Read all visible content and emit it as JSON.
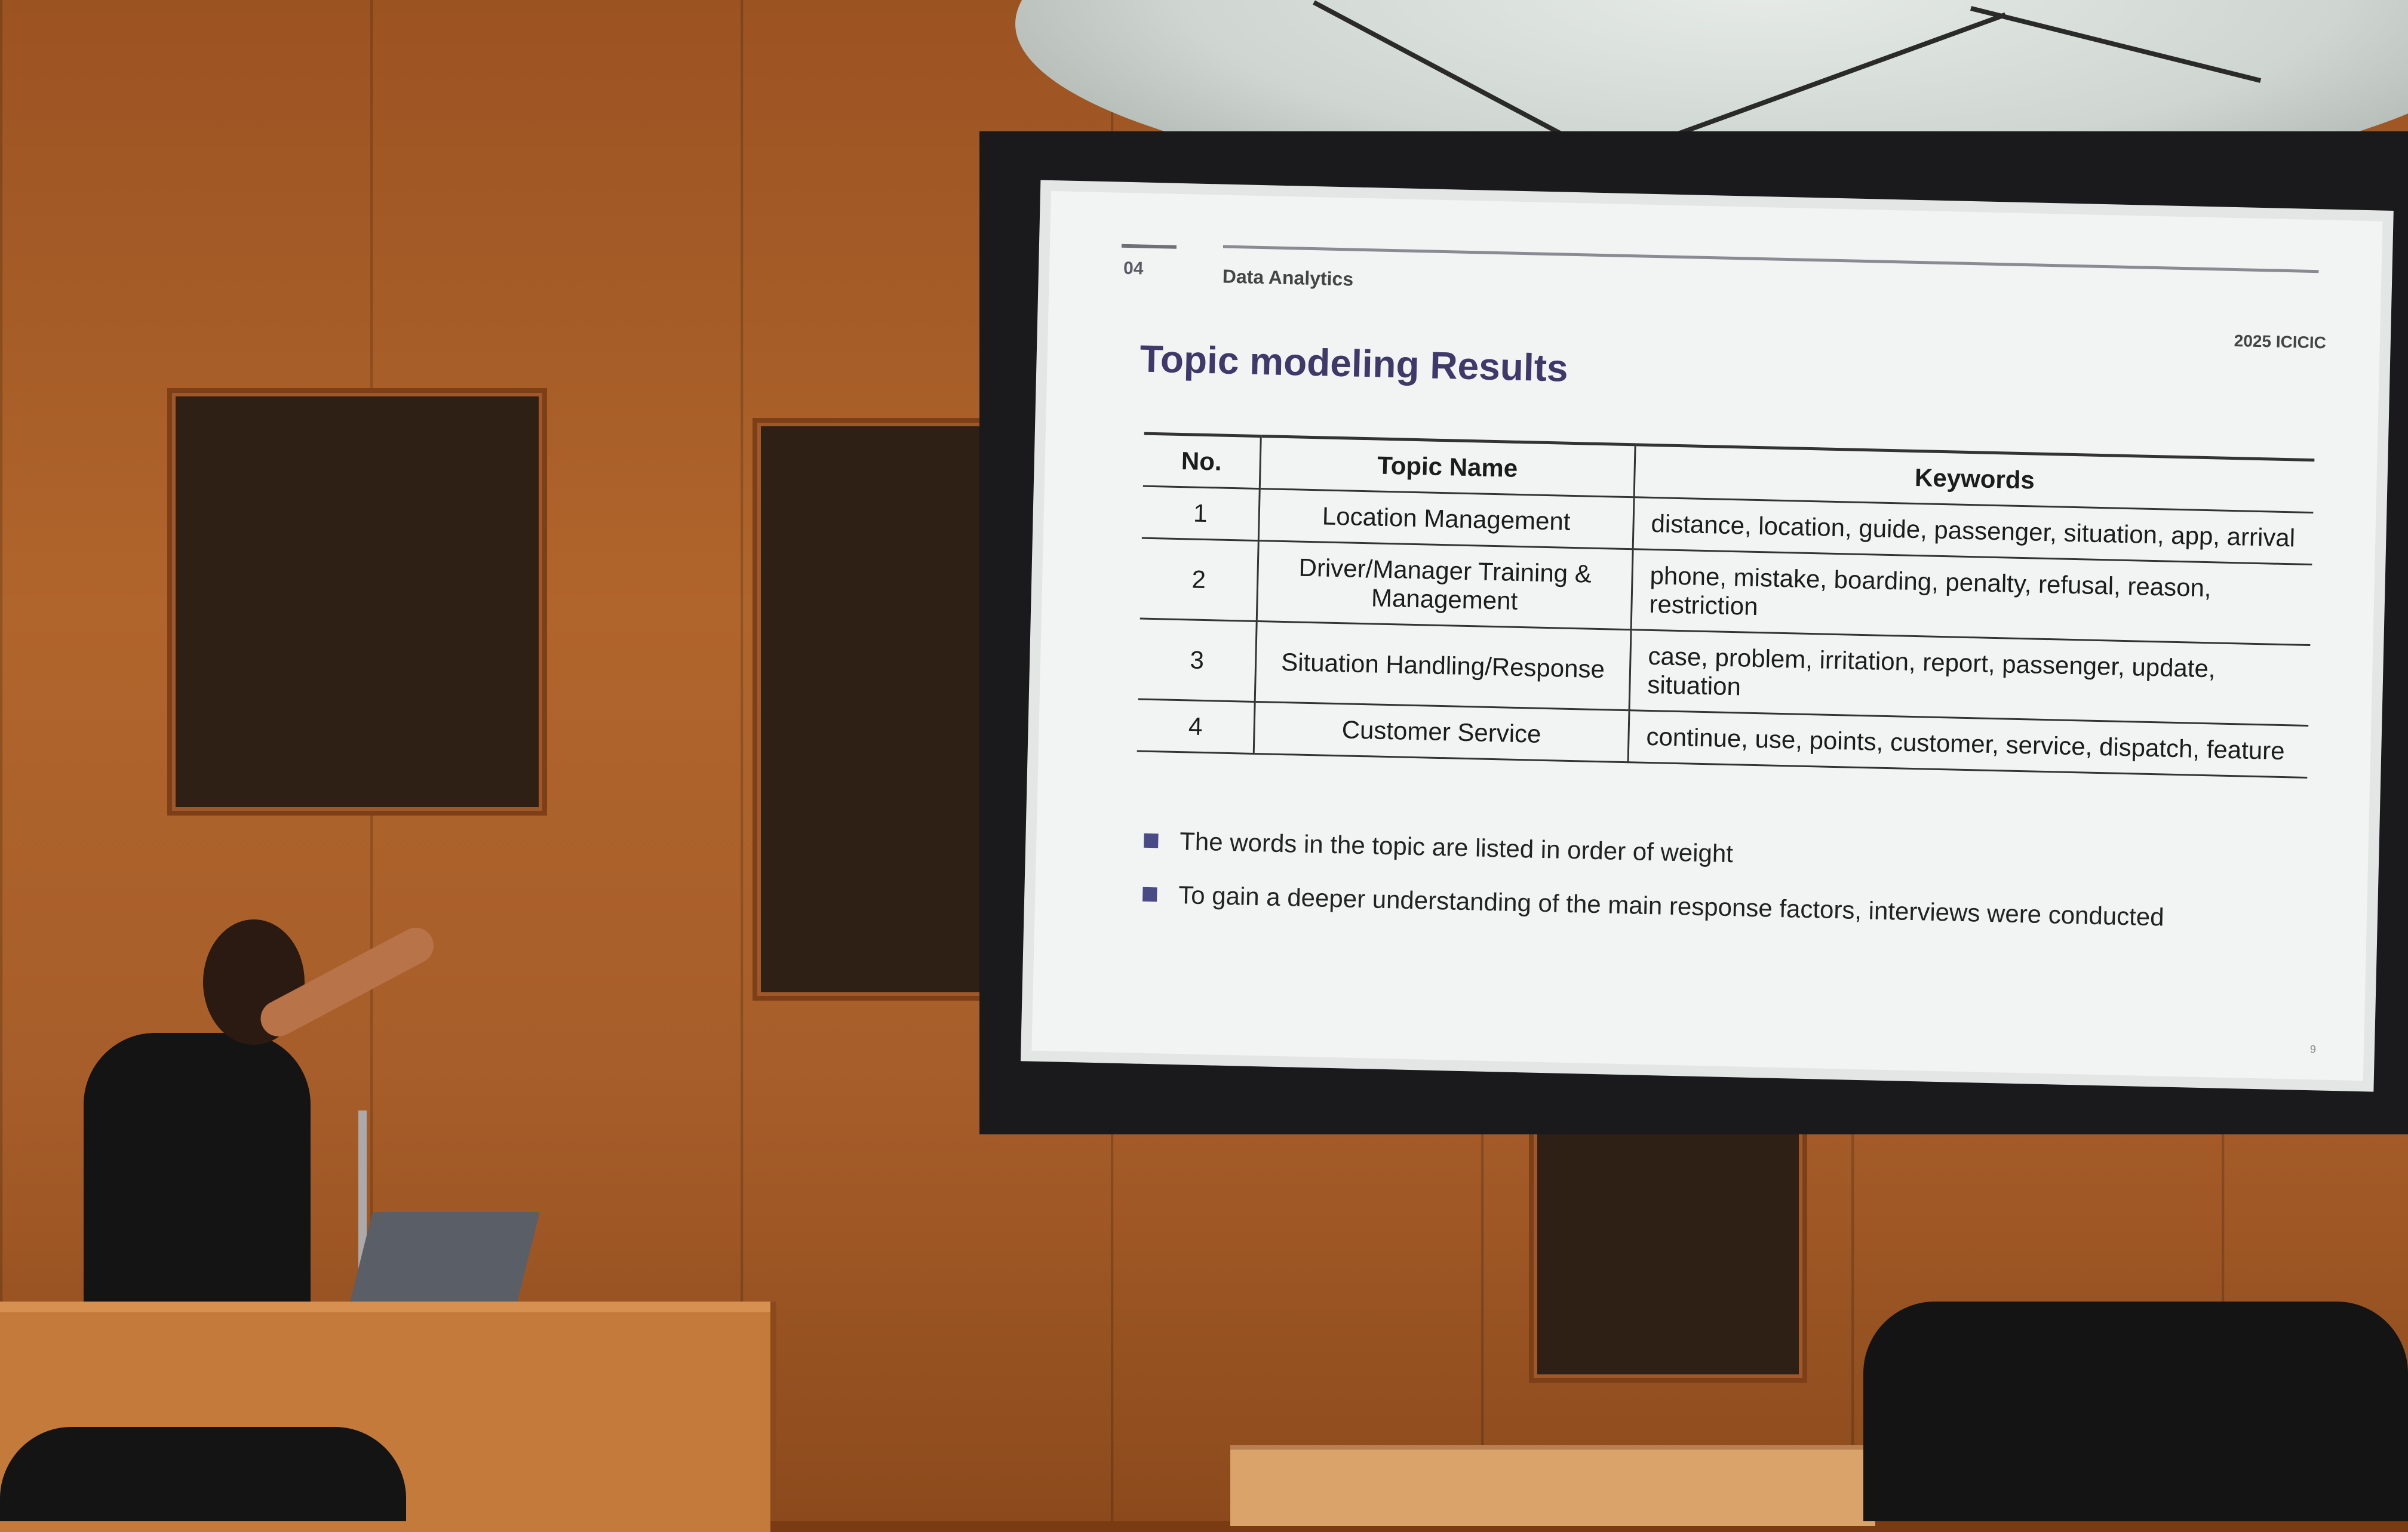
{
  "slide": {
    "section_number": "04",
    "section_title": "Data Analytics",
    "conference": "2025 ICICIC",
    "title": "Topic modeling Results",
    "table": {
      "headers": [
        "No.",
        "Topic Name",
        "Keywords"
      ],
      "rows": [
        {
          "no": "1",
          "name": "Location Management",
          "keywords": "distance, location, guide, passenger, situation, app, arrival"
        },
        {
          "no": "2",
          "name": "Driver/Manager Training & Management",
          "keywords": "phone, mistake, boarding, penalty, refusal, reason, restriction"
        },
        {
          "no": "3",
          "name": "Situation Handling/Response",
          "keywords": "case, problem, irritation, report, passenger, update, situation"
        },
        {
          "no": "4",
          "name": "Customer Service",
          "keywords": "continue, use, points, customer, service, dispatch, feature"
        }
      ]
    },
    "bullets": [
      "The words in the topic are listed in order of weight",
      "To gain a deeper understanding of the main response factors, interviews were conducted"
    ],
    "page_number": "9",
    "accent_color": "#3d3a6a"
  }
}
